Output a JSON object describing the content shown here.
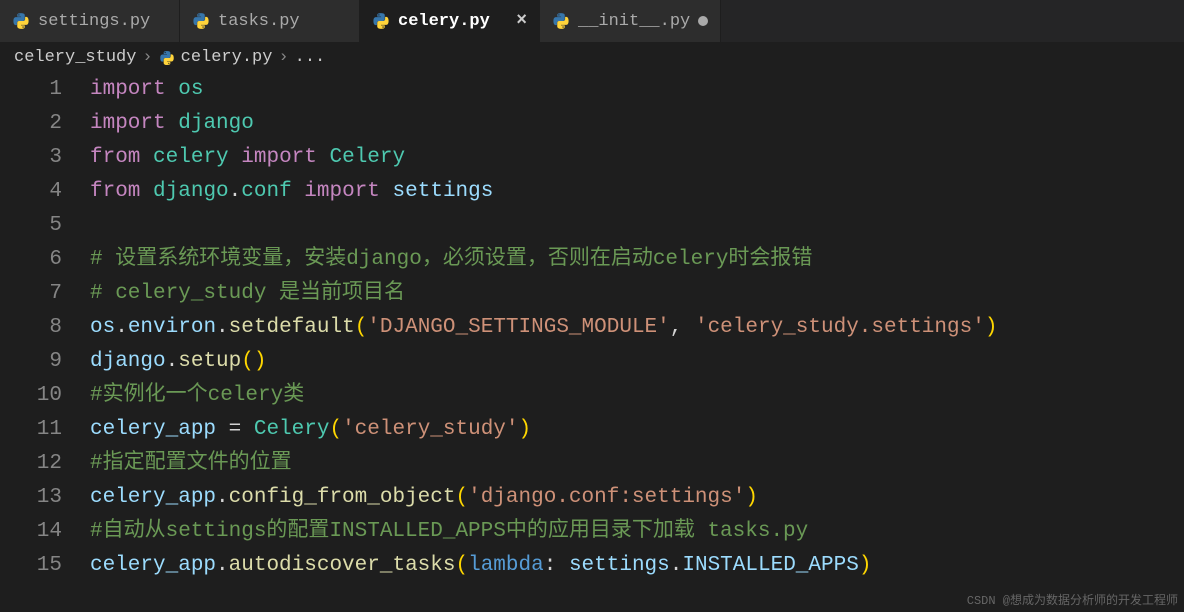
{
  "tabs": [
    {
      "label": "settings.py",
      "active": false,
      "modified": false
    },
    {
      "label": "tasks.py",
      "active": false,
      "modified": false
    },
    {
      "label": "celery.py",
      "active": true,
      "modified": false
    },
    {
      "label": "__init__.py",
      "active": false,
      "modified": true
    }
  ],
  "breadcrumb": {
    "folder": "celery_study",
    "file": "celery.py",
    "more": "..."
  },
  "code": {
    "lines": [
      {
        "n": "1",
        "t": [
          {
            "c": "kw",
            "v": "import"
          },
          {
            "c": "punc",
            "v": " "
          },
          {
            "c": "cls",
            "v": "os"
          }
        ]
      },
      {
        "n": "2",
        "t": [
          {
            "c": "kw",
            "v": "import"
          },
          {
            "c": "punc",
            "v": " "
          },
          {
            "c": "cls",
            "v": "django"
          }
        ]
      },
      {
        "n": "3",
        "t": [
          {
            "c": "kw",
            "v": "from"
          },
          {
            "c": "punc",
            "v": " "
          },
          {
            "c": "cls",
            "v": "celery"
          },
          {
            "c": "punc",
            "v": " "
          },
          {
            "c": "kw",
            "v": "import"
          },
          {
            "c": "punc",
            "v": " "
          },
          {
            "c": "cls",
            "v": "Celery"
          }
        ]
      },
      {
        "n": "4",
        "t": [
          {
            "c": "kw",
            "v": "from"
          },
          {
            "c": "punc",
            "v": " "
          },
          {
            "c": "cls",
            "v": "django"
          },
          {
            "c": "punc",
            "v": "."
          },
          {
            "c": "cls",
            "v": "conf"
          },
          {
            "c": "punc",
            "v": " "
          },
          {
            "c": "kw",
            "v": "import"
          },
          {
            "c": "punc",
            "v": " "
          },
          {
            "c": "ident",
            "v": "settings"
          }
        ]
      },
      {
        "n": "5",
        "t": []
      },
      {
        "n": "6",
        "t": [
          {
            "c": "com",
            "v": "# 设置系统环境变量，安装django，必须设置，否则在启动celery时会报错"
          }
        ]
      },
      {
        "n": "7",
        "t": [
          {
            "c": "com",
            "v": "# celery_study 是当前项目名"
          }
        ]
      },
      {
        "n": "8",
        "t": [
          {
            "c": "ident",
            "v": "os"
          },
          {
            "c": "punc",
            "v": "."
          },
          {
            "c": "ident",
            "v": "environ"
          },
          {
            "c": "punc",
            "v": "."
          },
          {
            "c": "fn",
            "v": "setdefault"
          },
          {
            "c": "ylwbr",
            "v": "("
          },
          {
            "c": "str",
            "v": "'DJANGO_SETTINGS_MODULE'"
          },
          {
            "c": "punc",
            "v": ", "
          },
          {
            "c": "str",
            "v": "'celery_study.settings'"
          },
          {
            "c": "ylwbr",
            "v": ")"
          }
        ]
      },
      {
        "n": "9",
        "t": [
          {
            "c": "ident",
            "v": "django"
          },
          {
            "c": "punc",
            "v": "."
          },
          {
            "c": "fn",
            "v": "setup"
          },
          {
            "c": "ylwbr",
            "v": "()"
          }
        ]
      },
      {
        "n": "10",
        "t": [
          {
            "c": "com",
            "v": "#实例化一个celery类"
          }
        ]
      },
      {
        "n": "11",
        "t": [
          {
            "c": "ident",
            "v": "celery_app"
          },
          {
            "c": "punc",
            "v": " = "
          },
          {
            "c": "cls",
            "v": "Celery"
          },
          {
            "c": "ylwbr",
            "v": "("
          },
          {
            "c": "str",
            "v": "'celery_study'"
          },
          {
            "c": "ylwbr",
            "v": ")"
          }
        ]
      },
      {
        "n": "12",
        "t": [
          {
            "c": "com",
            "v": "#指定配置文件的位置"
          }
        ]
      },
      {
        "n": "13",
        "t": [
          {
            "c": "ident",
            "v": "celery_app"
          },
          {
            "c": "punc",
            "v": "."
          },
          {
            "c": "fn",
            "v": "config_from_object"
          },
          {
            "c": "ylwbr",
            "v": "("
          },
          {
            "c": "str",
            "v": "'django.conf:settings'"
          },
          {
            "c": "ylwbr",
            "v": ")"
          }
        ]
      },
      {
        "n": "14",
        "t": [
          {
            "c": "com",
            "v": "#自动从settings的配置INSTALLED_APPS中的应用目录下加载 tasks.py"
          }
        ]
      },
      {
        "n": "15",
        "t": [
          {
            "c": "ident",
            "v": "celery_app"
          },
          {
            "c": "punc",
            "v": "."
          },
          {
            "c": "fn",
            "v": "autodiscover_tasks"
          },
          {
            "c": "ylwbr",
            "v": "("
          },
          {
            "c": "blue",
            "v": "lambda"
          },
          {
            "c": "punc",
            "v": ": "
          },
          {
            "c": "ident",
            "v": "settings"
          },
          {
            "c": "punc",
            "v": "."
          },
          {
            "c": "ident",
            "v": "INSTALLED_APPS"
          },
          {
            "c": "ylwbr",
            "v": ")"
          }
        ]
      }
    ]
  },
  "watermark": "CSDN @想成为数据分析师的开发工程师"
}
